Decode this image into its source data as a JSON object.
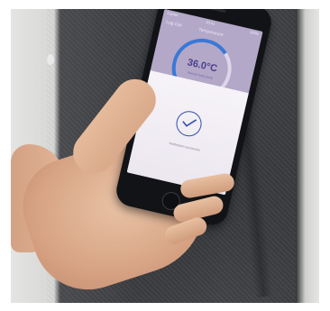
{
  "phone_screen": {
    "status_left": "Carrier",
    "status_time": "10:41",
    "status_right": "100%",
    "back_label": "Log Out",
    "header_title": "Temperature",
    "temperature": "36.0°C",
    "temperature_sub": "Normal body temp",
    "dialog_message": "Notification successful"
  },
  "colors": {
    "screen_bg": "#b3a8c8",
    "accent_blue": "#3a78d6",
    "check_blue": "#2f4fb0"
  },
  "icons": [
    "checkmark-icon"
  ]
}
